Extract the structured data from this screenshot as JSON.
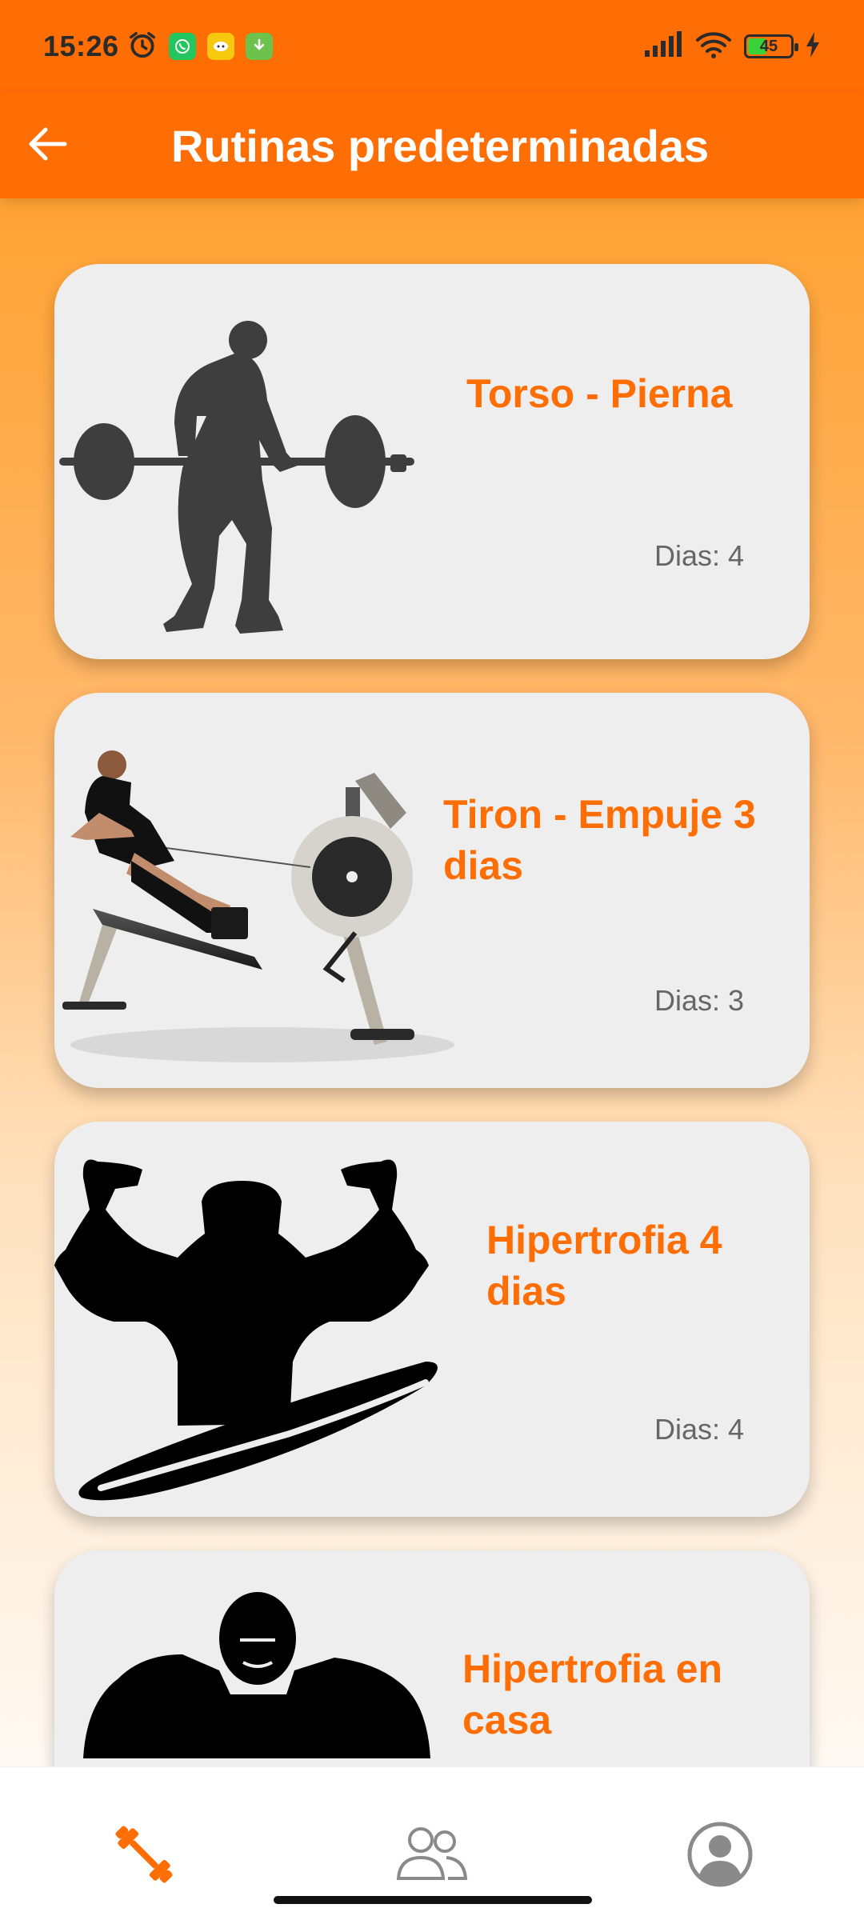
{
  "status": {
    "time": "15:26",
    "battery": "45",
    "battery_level": 0.45,
    "notifications": [
      "alarm-icon",
      "whatsapp-icon",
      "chat-app-icon",
      "download-icon"
    ]
  },
  "appbar": {
    "title": "Rutinas predeterminadas"
  },
  "routines": [
    {
      "title": "Torso - Pierna",
      "days": "Dias: 4",
      "image": "barbell-lifter-silhouette"
    },
    {
      "title": "Tiron - Empuje 3 dias",
      "days": "Dias: 3",
      "image": "rowing-machine-athlete"
    },
    {
      "title": "Hipertrofia 4 dias",
      "days": "Dias: 4",
      "image": "flexing-bodybuilder-silhouette"
    },
    {
      "title": "Hipertrofia en casa",
      "days": "",
      "image": "muscular-man-silhouette"
    }
  ],
  "bottom_nav": {
    "items": [
      "dumbbell-icon",
      "people-icon",
      "profile-icon"
    ],
    "active": "dumbbell-icon"
  },
  "colors": {
    "accent": "#ff6d05",
    "card_bg": "#eeeeee",
    "days_text": "#666666"
  }
}
